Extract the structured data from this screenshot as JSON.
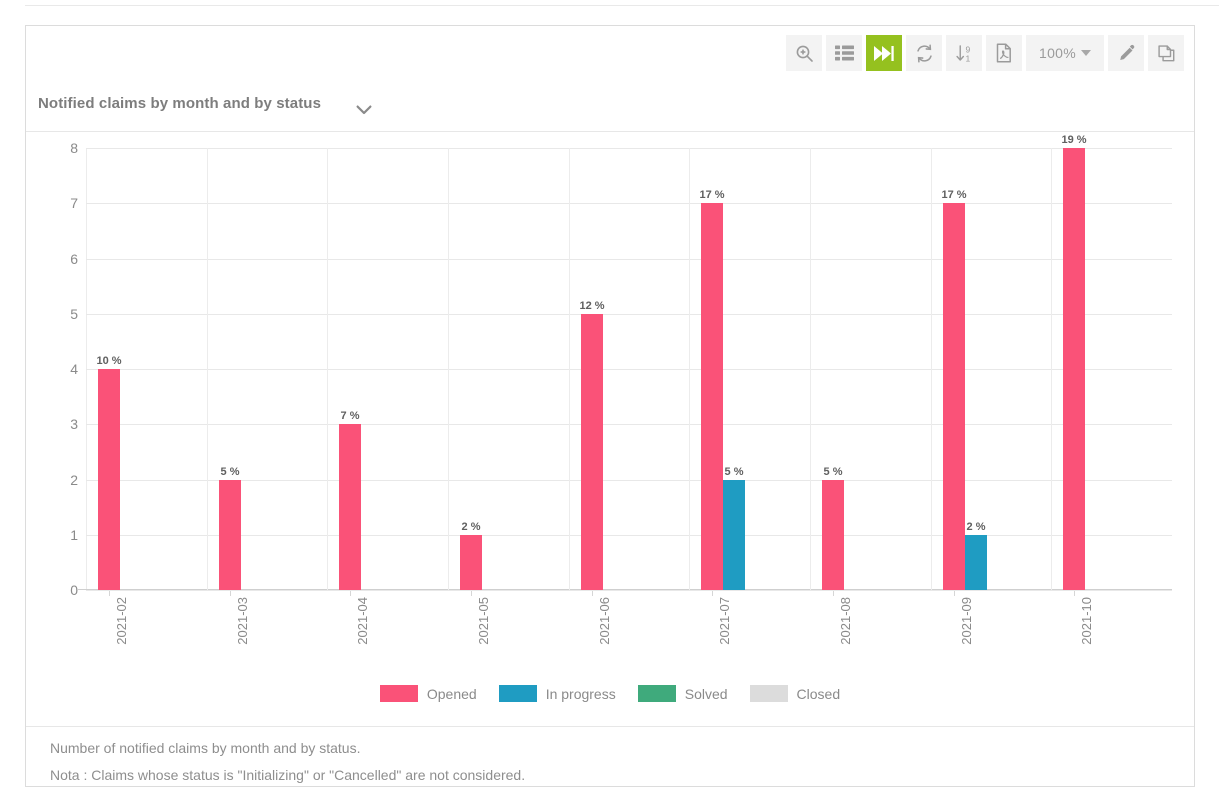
{
  "toolbar": {
    "buttons": [
      {
        "name": "zoom-in-icon",
        "title": "Zoom",
        "active": false
      },
      {
        "name": "table-view-icon",
        "title": "Table view",
        "active": false
      },
      {
        "name": "skip-forward-icon",
        "title": "Go to end",
        "active": true
      },
      {
        "name": "refresh-icon",
        "title": "Refresh",
        "active": false
      },
      {
        "name": "sort-descending-icon",
        "title": "Sort 9 to 1",
        "active": false
      },
      {
        "name": "pdf-export-icon",
        "title": "Export PDF",
        "active": false
      }
    ],
    "zoom_value": "100%",
    "edit_title": "Edit",
    "copy_title": "Copy"
  },
  "panel": {
    "title": "Notified claims by month and by status"
  },
  "footer": {
    "line1": "Number of notified claims by month and by status.",
    "line2": "Nota : Claims whose status is \"Initializing\" or \"Cancelled\" are not considered."
  },
  "chart_data": {
    "type": "bar",
    "title": "Notified claims by month and by status",
    "xlabel": "",
    "ylabel": "",
    "ylim": [
      0,
      8
    ],
    "yticks": [
      0,
      1,
      2,
      3,
      4,
      5,
      6,
      7,
      8
    ],
    "grid": true,
    "legend_position": "bottom",
    "categories": [
      "2021-02",
      "2021-03",
      "2021-04",
      "2021-05",
      "2021-06",
      "2021-07",
      "2021-08",
      "2021-09",
      "2021-10"
    ],
    "series": [
      {
        "name": "Opened",
        "color": "#fa5278",
        "values": [
          4,
          2,
          3,
          1,
          5,
          7,
          2,
          7,
          8
        ],
        "labels": [
          "10 %",
          "5 %",
          "7 %",
          "2 %",
          "12 %",
          "17 %",
          "5 %",
          "17 %",
          "19 %"
        ]
      },
      {
        "name": "In progress",
        "color": "#1f9cc2",
        "values": [
          0,
          0,
          0,
          0,
          0,
          2,
          0,
          1,
          0
        ],
        "labels": [
          "",
          "",
          "",
          "",
          "",
          "5 %",
          "",
          "2 %",
          ""
        ]
      },
      {
        "name": "Solved",
        "color": "#3faa7c",
        "values": [
          0,
          0,
          0,
          0,
          0,
          0,
          0,
          0,
          0
        ],
        "labels": [
          "",
          "",
          "",
          "",
          "",
          "",
          "",
          "",
          ""
        ]
      },
      {
        "name": "Closed",
        "color": "#dcdcdc",
        "values": [
          0,
          0,
          0,
          0,
          0,
          0,
          0,
          0,
          0
        ],
        "labels": [
          "",
          "",
          "",
          "",
          "",
          "",
          "",
          "",
          ""
        ]
      }
    ]
  }
}
